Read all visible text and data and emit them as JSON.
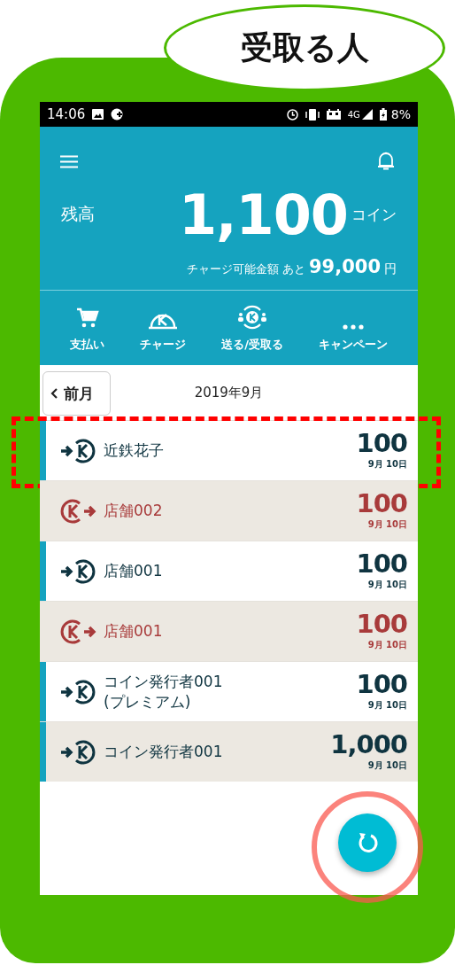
{
  "callout": {
    "label": "受取る人"
  },
  "status_bar": {
    "time": "14:06",
    "network": "4G",
    "battery": "8%"
  },
  "balance": {
    "label": "残高",
    "amount": "1,100",
    "unit": "コイン"
  },
  "charge_limit": {
    "label": "チャージ可能金額 あと",
    "amount": "99,000",
    "unit": "円"
  },
  "actions": [
    {
      "label": "支払い",
      "kind": "cart"
    },
    {
      "label": "チャージ",
      "kind": "charge"
    },
    {
      "label": "送る/受取る",
      "kind": "transfer"
    },
    {
      "label": "キャンペーン",
      "kind": "more"
    }
  ],
  "month_nav": {
    "prev": "前月",
    "current": "2019年9月"
  },
  "transactions": [
    {
      "kind": "receive",
      "name": "近鉄花子",
      "amount": "100",
      "date": "9月 10日",
      "highlighted": true
    },
    {
      "kind": "send",
      "name": "店舗002",
      "amount": "100",
      "date": "9月 10日",
      "highlighted": false
    },
    {
      "kind": "receive",
      "name": "店舗001",
      "amount": "100",
      "date": "9月 10日",
      "highlighted": false
    },
    {
      "kind": "send",
      "name": "店舗001",
      "amount": "100",
      "date": "9月 10日",
      "highlighted": false
    },
    {
      "kind": "receive",
      "name": "コイン発行者001\n(プレミアム)",
      "amount": "100",
      "date": "9月 10日",
      "highlighted": false
    },
    {
      "kind": "receive",
      "name": "コイン発行者001",
      "amount": "1,000",
      "date": "9月 10日",
      "highlighted": false
    }
  ],
  "refresh": {
    "highlighted": true
  }
}
